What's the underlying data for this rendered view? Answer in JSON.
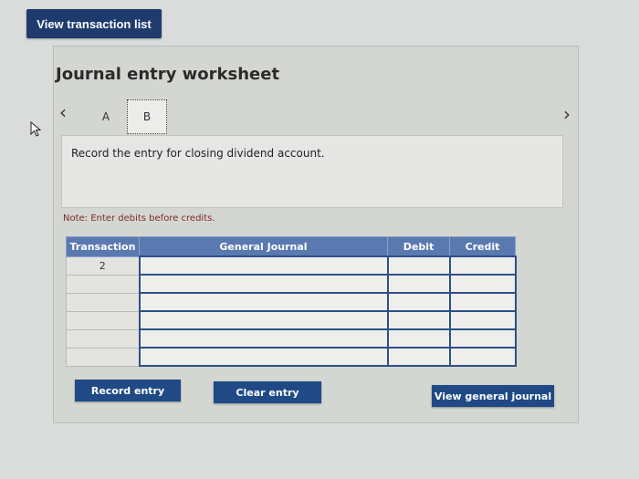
{
  "toolbar": {
    "view_transaction_list": "View transaction list"
  },
  "worksheet": {
    "title": "Journal entry worksheet",
    "tabs": [
      {
        "label": "A"
      },
      {
        "label": "B"
      }
    ],
    "active_tab": "B",
    "instruction": "Record the entry for closing dividend account.",
    "note": "Note: Enter debits before credits."
  },
  "table": {
    "headers": {
      "transaction": "Transaction",
      "general_journal": "General Journal",
      "debit": "Debit",
      "credit": "Credit"
    },
    "rows": [
      {
        "transaction": "2",
        "account": "",
        "debit": "",
        "credit": ""
      },
      {
        "transaction": "",
        "account": "",
        "debit": "",
        "credit": ""
      },
      {
        "transaction": "",
        "account": "",
        "debit": "",
        "credit": ""
      },
      {
        "transaction": "",
        "account": "",
        "debit": "",
        "credit": ""
      },
      {
        "transaction": "",
        "account": "",
        "debit": "",
        "credit": ""
      },
      {
        "transaction": "",
        "account": "",
        "debit": "",
        "credit": ""
      }
    ]
  },
  "buttons": {
    "record_entry": "Record entry",
    "clear_entry": "Clear entry",
    "view_general_journal": "View general journal"
  },
  "icons": {
    "prev": "chevron-left-icon",
    "next": "chevron-right-icon",
    "pointer": "mouse-pointer-icon"
  },
  "colors": {
    "primary_button": "#1f4a86",
    "header_blue": "#5b79b1",
    "top_button": "#1f3b6e"
  }
}
